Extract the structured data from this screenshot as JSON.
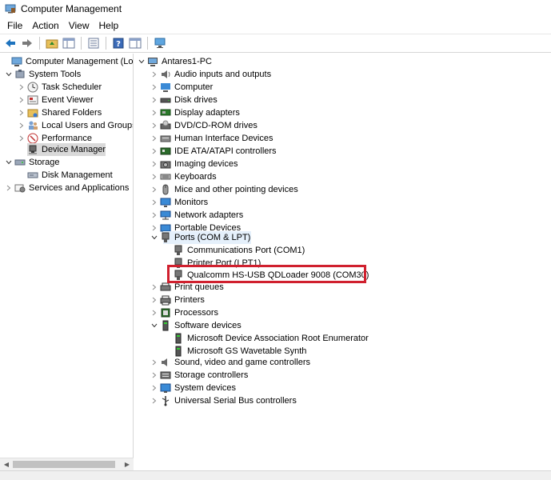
{
  "window": {
    "title": "Computer Management"
  },
  "menu": [
    "File",
    "Action",
    "View",
    "Help"
  ],
  "toolbar": {
    "icons": [
      "back-arrow-icon",
      "forward-arrow-icon",
      "up-folder-icon",
      "show-hide-tree-icon",
      "export-list-icon",
      "help-icon",
      "action-pane-icon",
      "monitor-icon"
    ]
  },
  "left_tree": {
    "root": "Computer Management (Local",
    "system_tools": "System Tools",
    "task_scheduler": "Task Scheduler",
    "event_viewer": "Event Viewer",
    "shared_folders": "Shared Folders",
    "local_users": "Local Users and Groups",
    "performance": "Performance",
    "device_manager": "Device Manager",
    "storage": "Storage",
    "disk_management": "Disk Management",
    "services": "Services and Applications"
  },
  "device_tree": {
    "root": "Antares1-PC",
    "categories": [
      "Audio inputs and outputs",
      "Computer",
      "Disk drives",
      "Display adapters",
      "DVD/CD-ROM drives",
      "Human Interface Devices",
      "IDE ATA/ATAPI controllers",
      "Imaging devices",
      "Keyboards",
      "Mice and other pointing devices",
      "Monitors",
      "Network adapters",
      "Portable Devices"
    ],
    "ports": {
      "label": "Ports (COM & LPT)",
      "children": [
        "Communications Port (COM1)",
        "Printer Port (LPT1)",
        "Qualcomm HS-USB QDLoader 9008 (COM30)"
      ]
    },
    "after_ports": [
      "Print queues",
      "Printers",
      "Processors"
    ],
    "software": {
      "label": "Software devices",
      "children": [
        "Microsoft Device Association Root Enumerator",
        "Microsoft GS Wavetable Synth"
      ]
    },
    "tail": [
      "Sound, video and game controllers",
      "Storage controllers",
      "System devices",
      "Universal Serial Bus controllers"
    ]
  },
  "colors": {
    "highlight": "#d0202e",
    "selected": "#d9d9d9",
    "accent": "#1e73be"
  }
}
